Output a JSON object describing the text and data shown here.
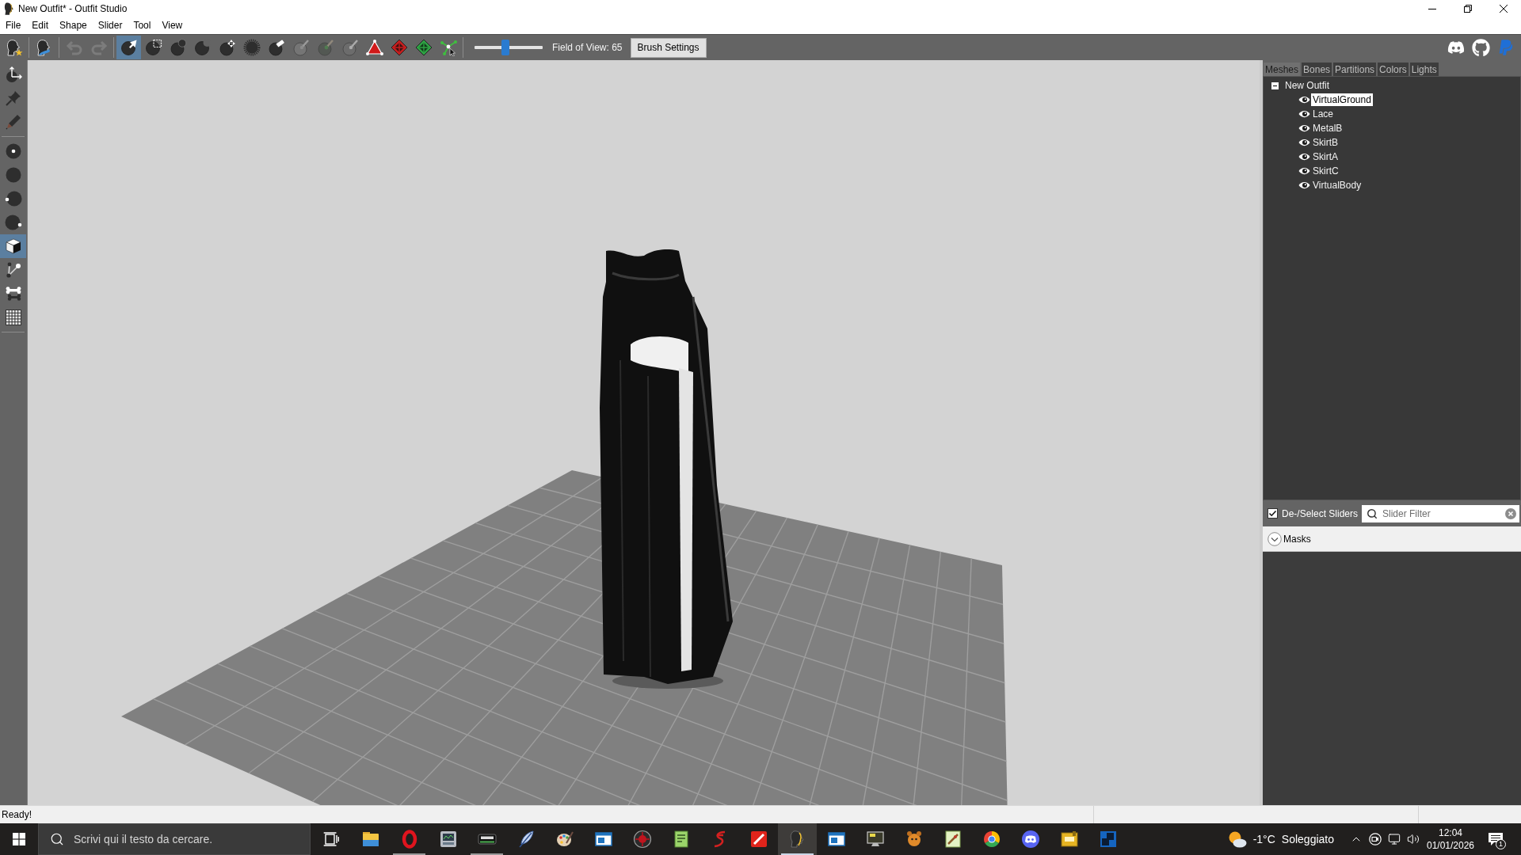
{
  "window": {
    "title": "New Outfit* - Outfit Studio"
  },
  "menu": [
    "File",
    "Edit",
    "Shape",
    "Slider",
    "Tool",
    "View"
  ],
  "toolbar": {
    "tools": [
      {
        "selected": false,
        "disabled": false
      },
      {
        "selected": false,
        "disabled": false
      },
      {
        "selected": false,
        "disabled": true
      },
      {
        "selected": false,
        "disabled": true
      },
      {
        "selected": true,
        "disabled": false
      },
      {
        "selected": false,
        "disabled": false
      },
      {
        "selected": false,
        "disabled": false
      },
      {
        "selected": false,
        "disabled": false
      },
      {
        "selected": false,
        "disabled": false
      },
      {
        "selected": false,
        "disabled": false
      },
      {
        "selected": false,
        "disabled": false
      },
      {
        "selected": false,
        "disabled": true
      },
      {
        "selected": false,
        "disabled": true
      },
      {
        "selected": false,
        "disabled": true
      },
      {
        "selected": false,
        "disabled": false
      },
      {
        "selected": false,
        "disabled": false
      },
      {
        "selected": false,
        "disabled": false
      },
      {
        "selected": false,
        "disabled": false
      }
    ],
    "fov_slider": {
      "level": 0.45
    },
    "fov_label": "Field of View: 65",
    "brush_settings": "Brush Settings"
  },
  "side_tools": [
    {
      "selected": false
    },
    {
      "selected": false
    },
    {
      "selected": false
    },
    {
      "selected": false
    },
    {
      "selected": false
    },
    {
      "selected": false
    },
    {
      "selected": false
    },
    {
      "selected": true
    },
    {
      "selected": false
    },
    {
      "selected": false
    },
    {
      "selected": false
    }
  ],
  "panel": {
    "tabs": [
      {
        "label": "Meshes",
        "selected": true
      },
      {
        "label": "Bones",
        "selected": false
      },
      {
        "label": "Partitions",
        "selected": false
      },
      {
        "label": "Colors",
        "selected": false
      },
      {
        "label": "Lights",
        "selected": false
      }
    ],
    "tree": {
      "label": "New Outfit",
      "expanded": true,
      "children": [
        {
          "label": "VirtualGround",
          "visible": true,
          "selected": true
        },
        {
          "label": "Lace",
          "visible": true,
          "selected": false
        },
        {
          "label": "MetalB",
          "visible": true,
          "selected": false
        },
        {
          "label": "SkirtB",
          "visible": true,
          "selected": false
        },
        {
          "label": "SkirtA",
          "visible": true,
          "selected": false
        },
        {
          "label": "SkirtC",
          "visible": true,
          "selected": false
        },
        {
          "label": "VirtualBody",
          "visible": true,
          "selected": false
        }
      ]
    },
    "select_sliders": {
      "label": "De-/Select Sliders",
      "checked": true
    },
    "slider_filter": {
      "placeholder": "Slider Filter"
    },
    "groups": [
      {
        "label": "Masks",
        "expanded": false
      }
    ]
  },
  "status_bar": {
    "text": "Ready!"
  },
  "taskbar": {
    "search": {
      "placeholder": "Scrivi qui il testo da cercare."
    },
    "apps": [
      {
        "running": false,
        "selected": false
      },
      {
        "running": true,
        "selected": false
      },
      {
        "running": false,
        "selected": false
      },
      {
        "running": true,
        "selected": false
      },
      {
        "running": false,
        "selected": false
      },
      {
        "running": false,
        "selected": false
      },
      {
        "running": false,
        "selected": false
      },
      {
        "running": false,
        "selected": false
      },
      {
        "running": false,
        "selected": false
      },
      {
        "running": false,
        "selected": false
      },
      {
        "running": false,
        "selected": false
      },
      {
        "running": true,
        "selected": true
      },
      {
        "running": false,
        "selected": false
      },
      {
        "running": false,
        "selected": false
      },
      {
        "running": false,
        "selected": false
      },
      {
        "running": false,
        "selected": false
      },
      {
        "running": false,
        "selected": false
      },
      {
        "running": false,
        "selected": false
      },
      {
        "running": false,
        "selected": false
      },
      {
        "running": false,
        "selected": false
      }
    ],
    "weather": {
      "temperature": "-1°C",
      "condition": "Soleggiato"
    },
    "clock": {
      "time": "12:04",
      "date": "01/01/2026"
    },
    "notifications": {
      "count": "1"
    }
  }
}
